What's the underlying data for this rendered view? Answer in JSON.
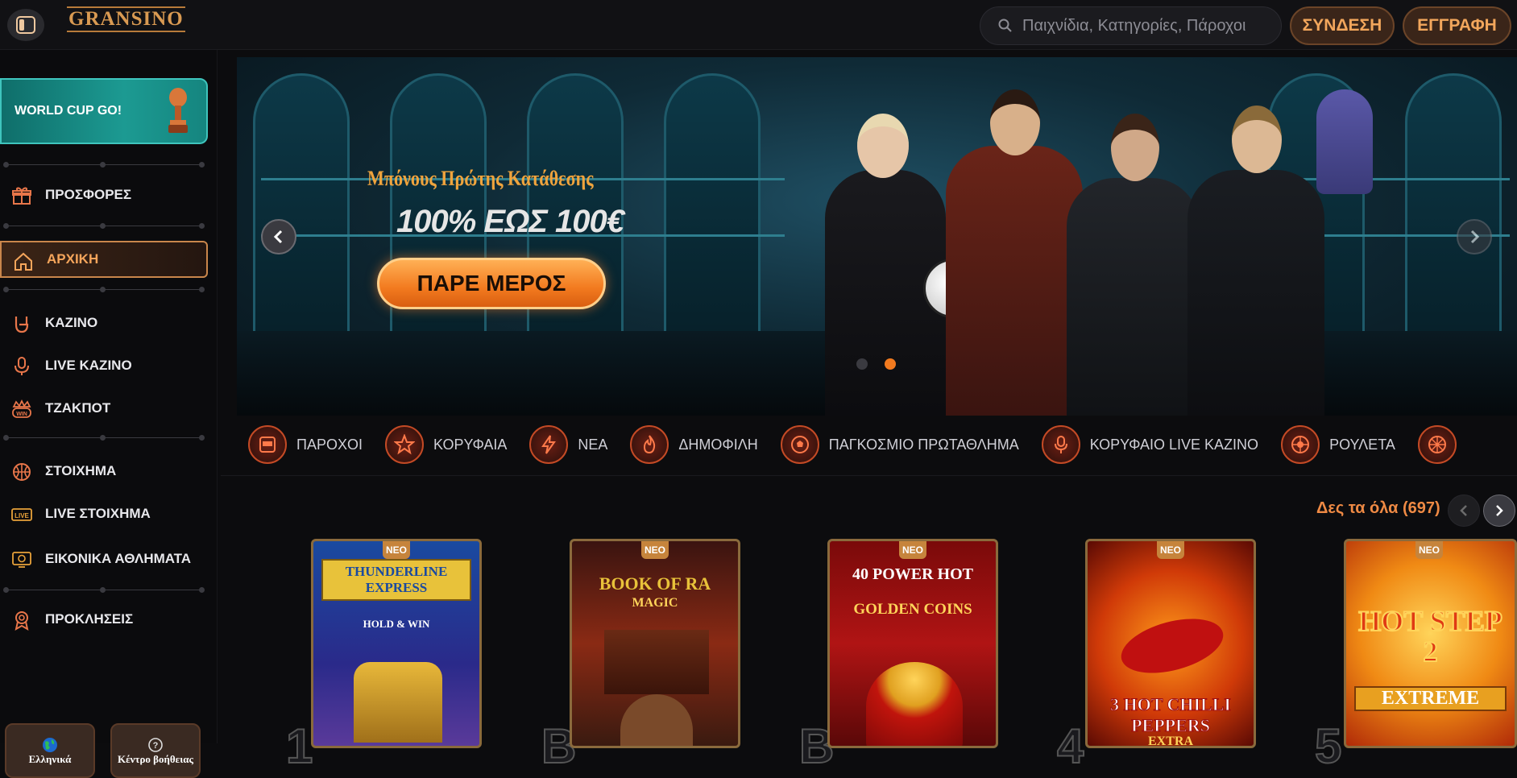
{
  "header": {
    "logo": "GRANSINO",
    "search_placeholder": "Παιχνίδια, Κατηγορίες, Πάροχοι",
    "login_label": "ΣΥΝΔΕΣΗ",
    "register_label": "ΕΓΓΡΑΦΗ"
  },
  "sidebar": {
    "promo": "WORLD CUP GO!",
    "items": [
      {
        "label": "ΠΡΟΣΦΟΡΕΣ",
        "icon": "gift-icon"
      },
      {
        "label": "ΑΡΧΙΚΗ",
        "icon": "home-icon",
        "active": true
      },
      {
        "label": "ΚΑΖΙΝΟ",
        "icon": "rock-hand-icon"
      },
      {
        "label": "LIVE ΚΑΖΙΝΟ",
        "icon": "microphone-icon"
      },
      {
        "label": "ΤΖΑΚΠΟΤ",
        "icon": "win-icon"
      },
      {
        "label": "ΣΤΟΙΧΗΜΑ",
        "icon": "basketball-icon"
      },
      {
        "label": "LIVE ΣΤΟΙΧΗΜΑ",
        "icon": "live-icon"
      },
      {
        "label": "ΕΙΚΟΝΙΚΑ ΑΘΛΗΜΑΤΑ",
        "icon": "virtual-sports-icon"
      },
      {
        "label": "ΠΡΟΚΛΗΣΕΙΣ",
        "icon": "award-icon"
      }
    ],
    "language_label": "Ελληνικά",
    "help_label": "Κέντρο βοήθειας"
  },
  "hero": {
    "subtitle": "Μπόνους Πρώτης Κατάθεσης",
    "title": "100% ΕΩΣ 100€",
    "cta": "ΠΑΡΕ ΜΕΡΟΣ",
    "active_slide": 2,
    "slide_count": 2
  },
  "categories": [
    {
      "label": "ΠΑΡΟΧΟΙ",
      "icon": "slot-machine-icon"
    },
    {
      "label": "ΚΟΡΥΦΑΙΑ",
      "icon": "star-icon"
    },
    {
      "label": "ΝΕΑ",
      "icon": "lightning-icon"
    },
    {
      "label": "ΔΗΜΟΦΙΛΗ",
      "icon": "fire-icon"
    },
    {
      "label": "ΠΑΓΚΟΣΜΙΟ ΠΡΩΤΑΘΛΗΜΑ",
      "icon": "soccer-ball-icon"
    },
    {
      "label": "ΚΟΡΥΦΑΙΟ LIVE ΚΑΖΙΝΟ",
      "icon": "microphone-icon"
    },
    {
      "label": "ΡΟΥΛΕΤΑ",
      "icon": "roulette-icon"
    }
  ],
  "games_section": {
    "see_all": "Δες τα όλα (697)",
    "badge": "ΝΕΟ",
    "games": [
      {
        "title": "THUNDERLINE EXPRESS",
        "sub": "HOLD & WIN"
      },
      {
        "title": "BOOK OF RA",
        "sub": "MAGIC"
      },
      {
        "title": "40 POWER HOT",
        "sub": "GOLDEN COINS"
      },
      {
        "title": "3 HOT CHILLI PEPPERS",
        "sub": "EXTRA"
      },
      {
        "title": "HOT STEP 2",
        "sub": "EXTREME"
      }
    ]
  },
  "colors": {
    "accent": "#f28a2e",
    "teal": "#1c9a92",
    "bg": "#0c0c0e"
  }
}
